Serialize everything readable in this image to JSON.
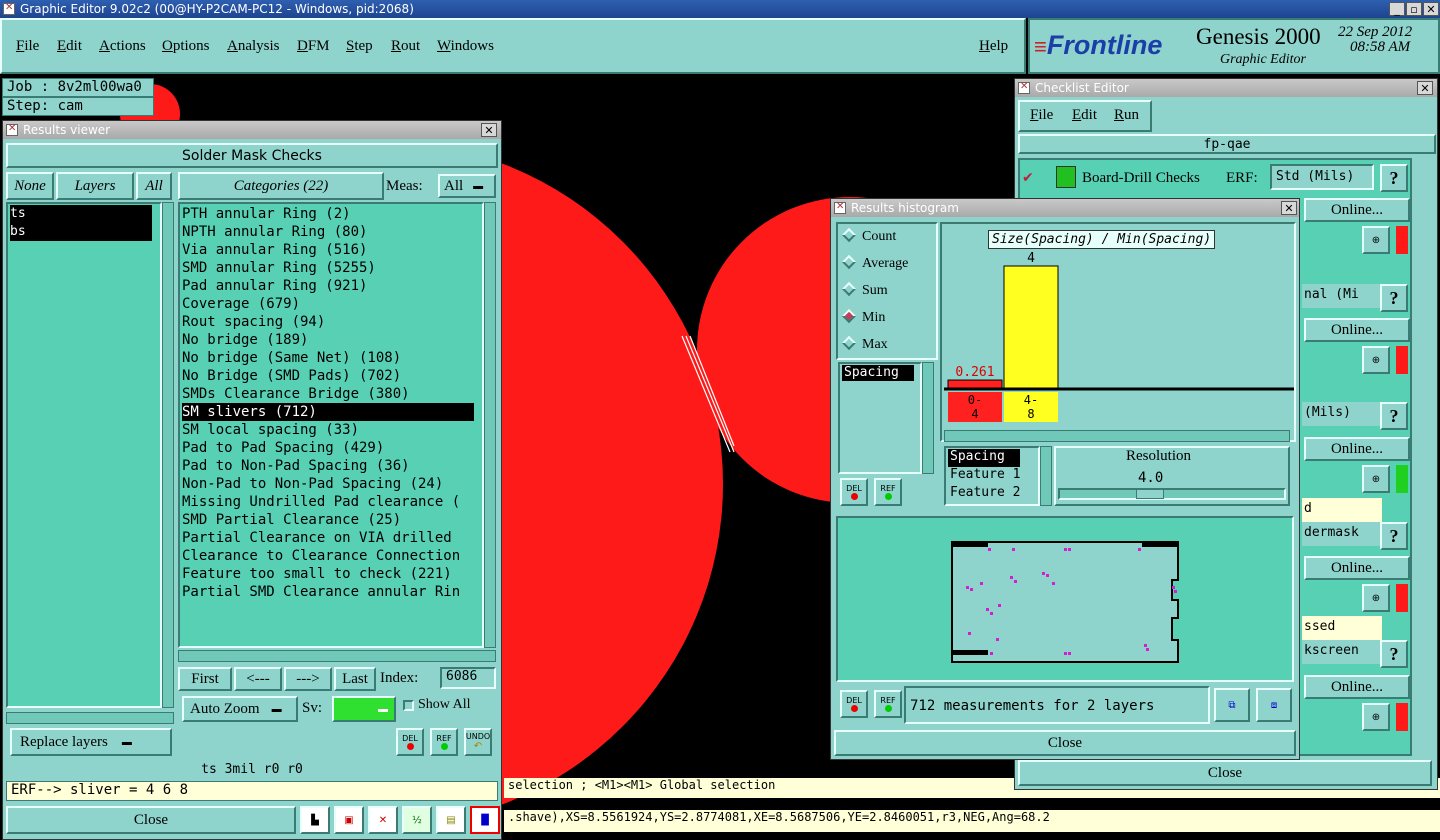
{
  "app": {
    "title": "Graphic Editor 9.02c2 (00@HY-P2CAM-PC12 - Windows, pid:2068)",
    "menu": [
      "File",
      "Edit",
      "Actions",
      "Options",
      "Analysis",
      "DFM",
      "Step",
      "Rout",
      "Windows"
    ],
    "help": "Help",
    "brand": "Frontline",
    "product": "Genesis 2000",
    "product_sub": "Graphic Editor",
    "date": "22 Sep 2012",
    "time": "08:58 AM",
    "job": "Job : 8v2ml00wa0",
    "step": "Step: cam"
  },
  "results_viewer": {
    "title": "Results viewer",
    "header": "Solder Mask Checks",
    "none_btn": "None",
    "layers_btn": "Layers",
    "all_btn": "All",
    "layers": [
      "ts",
      "bs"
    ],
    "categories_btn": "Categories (22)",
    "meas_label": "Meas:",
    "meas_value": "All",
    "categories": [
      "PTH annular Ring (2)",
      "NPTH annular Ring (80)",
      "Via annular Ring (516)",
      "SMD annular Ring (5255)",
      "Pad annular Ring (921)",
      "Coverage (679)",
      "Rout spacing (94)",
      "No bridge (189)",
      "No bridge (Same Net) (108)",
      "No Bridge (SMD Pads) (702)",
      "SMDs Clearance Bridge (380)",
      "SM slivers (712)",
      "SM local spacing (33)",
      "Pad to Pad Spacing (429)",
      "Pad to Non-Pad Spacing (36)",
      "Non-Pad to Non-Pad Spacing (24)",
      "Missing Undrilled Pad clearance (",
      "SMD Partial Clearance (25)",
      "Partial Clearance on VIA drilled",
      "Clearance to Clearance Connection",
      "Feature too small to check (221)",
      "Partial SMD Clearance annular Rin"
    ],
    "selected_index": 11,
    "first_btn": "First",
    "prev_btn": "<---",
    "next_btn": "--->",
    "last_btn": "Last",
    "index_label": "Index:",
    "index_value": "6086",
    "autozoom": "Auto Zoom",
    "sv_label": "Sv:",
    "show_all": "Show All",
    "replace_layers": "Replace layers",
    "del": "DEL",
    "ref": "REF",
    "undo": "UNDO",
    "status": "ts 3mil   r0   r0",
    "erf": "ERF--> sliver = 4 6 8",
    "close": "Close"
  },
  "histogram": {
    "title": "Results histogram",
    "radio": [
      "Count",
      "Average",
      "Sum",
      "Min",
      "Max"
    ],
    "radio_selected": 3,
    "list": [
      "Spacing"
    ],
    "chart_title": "Size(Spacing) / Min(Spacing)",
    "bars": [
      {
        "label": "0.261",
        "range": "0-\n4",
        "value": 0.261,
        "color": "#ff2020"
      },
      {
        "label": "4",
        "range": "4-\n8",
        "value": 4,
        "color": "#ffff20"
      }
    ],
    "attrs": [
      "Spacing",
      "Feature 1",
      "Feature 2"
    ],
    "resolution_label": "Resolution",
    "resolution_value": "4.0",
    "del": "DEL",
    "ref": "REF",
    "summary": "712 measurements for 2 layers",
    "close": "Close"
  },
  "checklist": {
    "title": "Checklist Editor",
    "menu": [
      "File",
      "Edit",
      "Run"
    ],
    "name": "fp-qae",
    "row_label": "Board-Drill Checks",
    "erf_label": "ERF:",
    "erf_value": "Std (Mils)",
    "online": "Online...",
    "fragments": [
      "nal (Mi",
      "(Mils)",
      "d",
      "dermask",
      "ssed",
      "kscreen"
    ],
    "close": "Close"
  },
  "status_line": {
    "hint": "selection ; <M1><M1> Global selection",
    "coords": ".shave),XS=8.5561924,YS=2.8774081,XE=8.5687506,YE=2.8460051,r3,NEG,Ang=68.2"
  }
}
